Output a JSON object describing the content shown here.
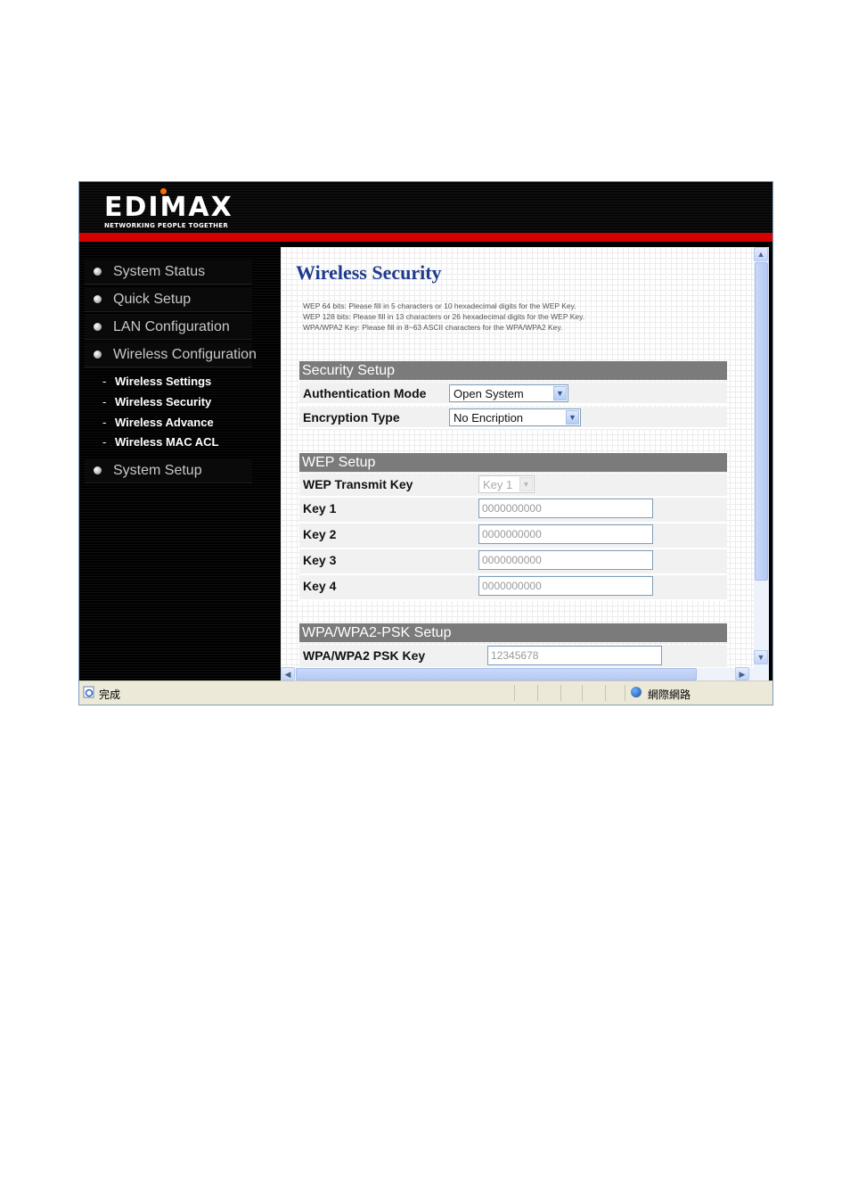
{
  "header": {
    "brand": "EDIMAX",
    "tagline": "NETWORKING PEOPLE TOGETHER"
  },
  "sidebar": {
    "items": [
      {
        "label": "System Status"
      },
      {
        "label": "Quick Setup"
      },
      {
        "label": "LAN Configuration"
      },
      {
        "label": "Wireless Configuration"
      },
      {
        "label": "System Setup"
      }
    ],
    "subitems": [
      {
        "label": "Wireless Settings"
      },
      {
        "label": "Wireless Security"
      },
      {
        "label": "Wireless Advance"
      },
      {
        "label": "Wireless MAC ACL"
      }
    ],
    "dash": "-"
  },
  "page": {
    "title": "Wireless Security",
    "notes": [
      "WEP 64 bits:   Please fill in 5 characters or 10 hexadecimal digits for the WEP Key.",
      "WEP 128 bits: Please fill in 13 characters or 26 hexadecimal digits for the WEP Key.",
      "WPA/WPA2 Key: Please fill in 8~63 ASCII characters for the WPA/WPA2 Key."
    ]
  },
  "security_setup": {
    "header": "Security Setup",
    "auth_label": "Authentication Mode",
    "auth_value": "Open System",
    "enc_label": "Encryption Type",
    "enc_value": "No Encription"
  },
  "wep_setup": {
    "header": "WEP Setup",
    "transmit_label": "WEP Transmit Key",
    "transmit_value": "Key 1",
    "keys": [
      {
        "label": "Key 1",
        "value": "0000000000"
      },
      {
        "label": "Key 2",
        "value": "0000000000"
      },
      {
        "label": "Key 3",
        "value": "0000000000"
      },
      {
        "label": "Key 4",
        "value": "0000000000"
      }
    ]
  },
  "wpa_setup": {
    "header": "WPA/WPA2-PSK Setup",
    "psk_label": "WPA/WPA2 PSK Key",
    "psk_value": "12345678"
  },
  "statusbar": {
    "status": "完成",
    "zone": "網際網路"
  },
  "icons": {
    "scroll_up": "scroll-up-icon",
    "scroll_down": "scroll-down-icon",
    "scroll_left": "scroll-left-icon",
    "scroll_right": "scroll-right-icon",
    "page_done": "ie-page-icon",
    "internet_zone": "globe-icon"
  },
  "colors": {
    "accent_red": "#d40000",
    "title_blue": "#1e3a8c",
    "section_gray": "#7b7b7b"
  }
}
